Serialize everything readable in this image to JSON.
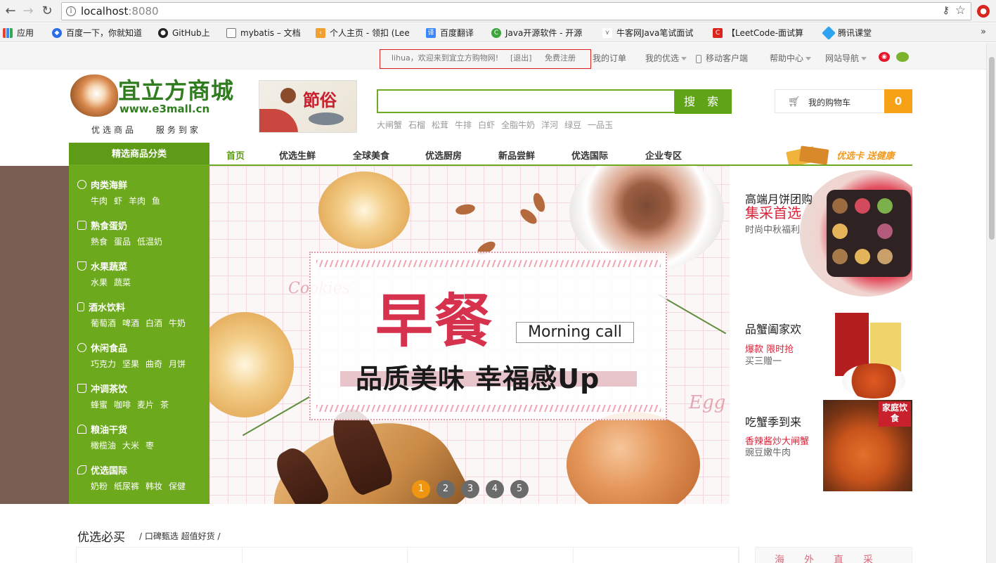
{
  "browser": {
    "url_host": "localhost",
    "url_port": ":8080",
    "bookmarks": [
      {
        "label": "应用",
        "icon": "apps-grid-icon",
        "color": "#4a7bd9"
      },
      {
        "label": "百度一下，你就知道",
        "icon": "baidu-paw-icon",
        "color": "#2b6de8"
      },
      {
        "label": "GitHub上",
        "icon": "github-icon",
        "color": "#222222"
      },
      {
        "label": "mybatis – 文档",
        "icon": "page-icon",
        "color": "#ffffff"
      },
      {
        "label": "个人主页 - 领扣 (Lee",
        "icon": "leetcode-icon",
        "color": "#f0a030"
      },
      {
        "label": "百度翻译",
        "icon": "translate-icon",
        "color": "#3a86ff"
      },
      {
        "label": "Java开源软件 - 开源",
        "icon": "oschina-icon",
        "color": "#3aa53a"
      },
      {
        "label": "牛客网Java笔试面试",
        "icon": "nowcoder-icon",
        "color": "#555555"
      },
      {
        "label": "【LeetCode-面试算",
        "icon": "csdn-icon",
        "color": "#d9251d"
      },
      {
        "label": "腾讯课堂",
        "icon": "tencent-class-icon",
        "color": "#2fa3f0"
      }
    ],
    "more": "»"
  },
  "topbar": {
    "welcome": "lihua，欢迎来到宜立方购物网!",
    "logout": "[退出]",
    "register": "免费注册",
    "my_orders": "我的订单",
    "my_picks": "我的优选",
    "mobile": "移动客户端",
    "help": "帮助中心",
    "site_nav": "网站导航"
  },
  "logo": {
    "name": "宜立方商城",
    "url": "www.e3mall.cn",
    "slogan": "优选商品  服务到家"
  },
  "festival_text": "節俗",
  "search": {
    "button": "搜 索",
    "value": "",
    "hotwords": [
      "大闸蟹",
      "石榴",
      "松茸",
      "牛排",
      "白虾",
      "全脂牛奶",
      "洋河",
      "绿豆",
      "一品玉"
    ]
  },
  "cart": {
    "label": "我的购物车",
    "count": "0"
  },
  "nav": {
    "category_head": "精选商品分类",
    "items": [
      "首页",
      "优选生鲜",
      "全球美食",
      "优选厨房",
      "新品尝鲜",
      "优选国际",
      "企业专区"
    ],
    "promo": "优选卡 送健康"
  },
  "categories": [
    {
      "title": "肉类海鲜",
      "icon": "fish-icon",
      "subs": [
        "牛肉",
        "虾",
        "羊肉",
        "鱼"
      ]
    },
    {
      "title": "熟食蛋奶",
      "icon": "milk-bottle-icon",
      "subs": [
        "熟食",
        "蛋品",
        "低温奶"
      ]
    },
    {
      "title": "水果蔬菜",
      "icon": "fruit-basket-icon",
      "subs": [
        "水果",
        "蔬菜"
      ]
    },
    {
      "title": "酒水饮料",
      "icon": "bottle-icon",
      "subs": [
        "葡萄酒",
        "啤酒",
        "白酒",
        "牛奶"
      ]
    },
    {
      "title": "休闲食品",
      "icon": "snack-icon",
      "subs": [
        "巧克力",
        "坚果",
        "曲奇",
        "月饼"
      ]
    },
    {
      "title": "冲调茶饮",
      "icon": "tea-cup-icon",
      "subs": [
        "蜂蜜",
        "咖啡",
        "麦片",
        "茶"
      ]
    },
    {
      "title": "粮油干货",
      "icon": "grain-bowl-icon",
      "subs": [
        "橄榄油",
        "大米",
        "枣"
      ]
    },
    {
      "title": "优选国际",
      "icon": "leaf-icon",
      "subs": [
        "奶粉",
        "纸尿裤",
        "韩妆",
        "保健"
      ]
    }
  ],
  "banner": {
    "headline": "早餐",
    "tag": "Morning call",
    "slogan": "品质美味 幸福感Up",
    "cookies_word": "Cookies",
    "egg_word": "Egg",
    "pages": [
      "1",
      "2",
      "3",
      "4",
      "5"
    ],
    "active_page": 0
  },
  "promos": [
    {
      "t1": "高端月饼团购",
      "t2": "集采首选",
      "t3": "时尚中秋福利"
    },
    {
      "t1": "品蟹阖家欢",
      "t4": "爆款 限时抢",
      "t5": "买三赠一"
    },
    {
      "t1": "吃蟹季到来",
      "t4": "香辣酱炒大闸蟹",
      "t5": "豌豆嫩牛肉",
      "badge": "家庭饮食"
    }
  ],
  "section": {
    "title": "优选必买",
    "subtitle": "/ 口碑甄选  超值好货 /",
    "side_title": "海外直采"
  },
  "colors": {
    "brand_green": "#5e9b17",
    "sidebar_green": "#6ca91c",
    "cart_orange": "#f7a117",
    "accent_red": "#d9253a"
  }
}
